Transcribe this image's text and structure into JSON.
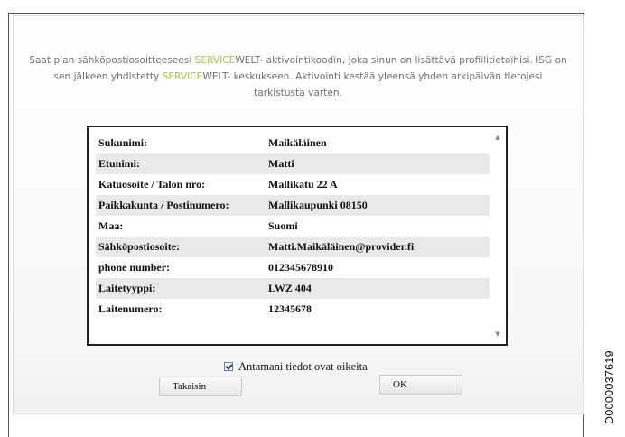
{
  "message": {
    "part1": "Saat pian sähköpostiosoitteeseesi ",
    "brand1": "SERVICE",
    "part2": "WELT- aktivointikoodin, joka sinun on lisättävä profiilitietoihisi. ISG on sen jälkeen yhdistetty ",
    "brand2": "SERVICE",
    "part3": "WELT- keskukseen. Aktivointi kestää yleensä yhden arkipäivän tietojesi tarkistusta varten."
  },
  "rows": [
    {
      "label": "Sukunimi:",
      "value": "Maikäläinen"
    },
    {
      "label": "Etunimi:",
      "value": "Matti"
    },
    {
      "label": "Katuosoite / Talon nro:",
      "value": "Mallikatu  22 A"
    },
    {
      "label": "Paikkakunta / Postinumero:",
      "value": "Mallikaupunki  08150"
    },
    {
      "label": "Maa:",
      "value": "Suomi"
    },
    {
      "label": "Sähköpostiosoite:",
      "value": "Matti.Maikäläinen@provider.fi"
    },
    {
      "label": "phone number:",
      "value": "012345678910"
    },
    {
      "label": "Laitetyyppi:",
      "value": "LWZ 404"
    },
    {
      "label": "Laitenumero:",
      "value": "12345678"
    }
  ],
  "confirm": {
    "label": "Antamani tiedot ovat oikeita",
    "checked": true
  },
  "buttons": {
    "back": "Takaisin",
    "ok": "OK"
  },
  "document_id": "D0000037619",
  "colors": {
    "brand_green": "#9bc94a",
    "text_gray": "#707070"
  }
}
